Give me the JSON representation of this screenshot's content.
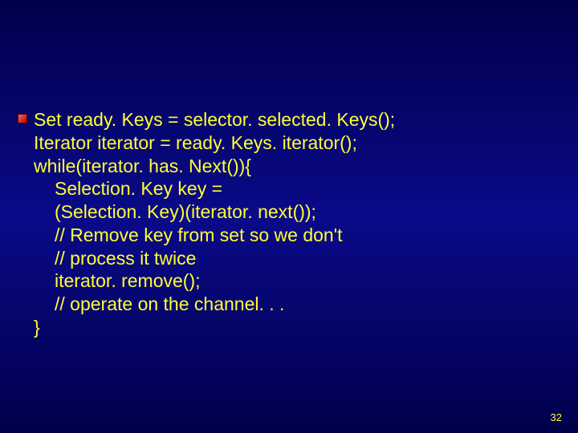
{
  "code": {
    "l1": "Set ready. Keys = selector. selected. Keys();",
    "l2": "Iterator iterator = ready. Keys. iterator();",
    "l3": "while(iterator. has. Next()){",
    "l4": "Selection. Key key =",
    "l5": "(Selection. Key)(iterator. next());",
    "l6": "// Remove key from set so we don't",
    "l7": "// process it twice",
    "l8": "iterator. remove();",
    "l9": "// operate on the channel. . .",
    "l10": "}"
  },
  "page_number": "32"
}
